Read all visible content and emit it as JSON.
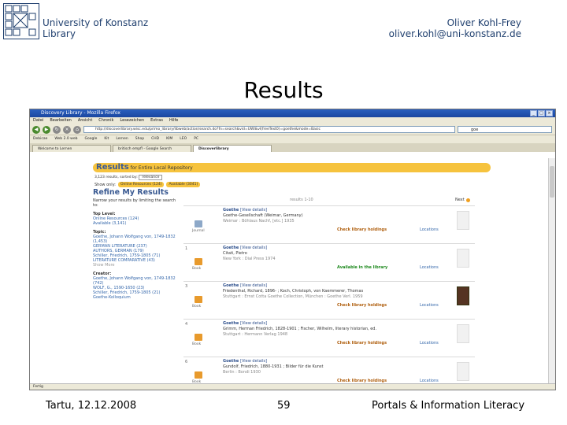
{
  "header": {
    "institution_line1": "University of Konstanz",
    "institution_line2": "Library",
    "author_name": "Oliver Kohl-Frey",
    "author_email": "oliver.kohl@uni-konstanz.de"
  },
  "slide_title": "Results",
  "footer": {
    "location_date": "Tartu, 12.12.2008",
    "page_number": "59",
    "topic": "Portals & Information Literacy"
  },
  "browser": {
    "window_title": "Discovery Library - Mozilla Firefox",
    "menu": [
      "Datei",
      "Bearbeiten",
      "Ansicht",
      "Chronik",
      "Lesezeichen",
      "Extras",
      "Hilfe"
    ],
    "url": "http://discoverlibrary.wisc.edu/primo_library/libweb/action/search.do?fn=search&vid=UWI&vl(freeText0)=goethe&mode=Basic",
    "search_box": "goe",
    "bookmarks": [
      "Debicae",
      "Web 2.0 web",
      "Google",
      "Kit",
      "Lernen",
      "Shop",
      "CHD",
      "KIM",
      "LEO",
      "PC"
    ],
    "tabs": [
      "Welcome to Lernen",
      "britisch empfl - Google Search",
      "Discoverlibrary"
    ],
    "status": "Fertig"
  },
  "results": {
    "banner_label": "Results",
    "banner_for": "for Entire Local Repository",
    "count_text": "3,123 results, sorted by:",
    "sort_value": "relevance",
    "show_only_label": "Show only:",
    "chips": [
      "Online Resources (124)",
      "Available (3041)"
    ],
    "pager": "results 1-10",
    "sort_link": "Next"
  },
  "refine": {
    "heading": "Refine My Results",
    "intro": "Narrow your results by limiting the search to:",
    "top_level_label": "Top Level:",
    "top_level": [
      "Online Resources (124)",
      "Available (3,141)"
    ],
    "topic_label": "Topic:",
    "topics": [
      "Goethe, Johann Wolfgang von, 1749-1832 (1,453)",
      "GERMAN LITERATURE (237)",
      "AUTHORS, GERMAN (179)",
      "Schiller, Friedrich, 1759-1805 (71)",
      "LITERATURE COMPARATIVE (43)"
    ],
    "show_more": "Show More",
    "creator_label": "Creator:",
    "creators": [
      "Goethe, Johann Wolfgang von, 1749-1832 (742)",
      "WOLF, G., 1590-1650 (23)",
      "Schiller, Friedrich, 1759-1805 (21)",
      "Goethe-Kolloquium"
    ]
  },
  "records": [
    {
      "num": "",
      "type": "Journal",
      "title": "Goethe",
      "details": "[View details]",
      "author": "Goethe-Gesellschaft (Weimar, Germany)",
      "pub": "Weimar : Böhlaus Nachf, [etc.] 1935",
      "availability": "Check library holdings",
      "locations": "Locations"
    },
    {
      "num": "1",
      "type": "Book",
      "title": "Goethe",
      "details": "[View details]",
      "author": "Citati, Pietro",
      "pub": "New York : Dial Press 1974",
      "availability": "Available in the library",
      "locations": "Locations"
    },
    {
      "num": "3",
      "type": "Book",
      "title": "Goethe",
      "details": "[View details]",
      "author": "Friedenthal, Richard, 1896-  ; Koch, Christoph, von Kaemmerer, Thomas",
      "pub": "Stuttgart : Ernst Cotta Goethe Collection, München : Goethe Verl. 1959",
      "availability": "Check library holdings",
      "locations": "Locations"
    },
    {
      "num": "4",
      "type": "Book",
      "title": "Goethe",
      "details": "[View details]",
      "author": "Grimm, Herman Friedrich, 1828-1901 ; Fischer, Wilhelm, literary historian, ed.",
      "pub": "Stuttgart : Hermann Verlag 1948",
      "availability": "Check library holdings",
      "locations": "Locations"
    },
    {
      "num": "6",
      "type": "Book",
      "title": "Goethe",
      "details": "[View details]",
      "author": "Gundolf, Friedrich, 1880-1931 ; Bilder für die Kunst",
      "pub": "Berlin : Bondi 1930",
      "availability": "Check library holdings",
      "locations": "Locations"
    }
  ],
  "colors": {
    "accent_yellow": "#f6c33e",
    "link_blue": "#3366aa",
    "header_text": "#1f3f6e",
    "available_green": "#1f8a1f",
    "holdings_orange": "#b06010"
  }
}
